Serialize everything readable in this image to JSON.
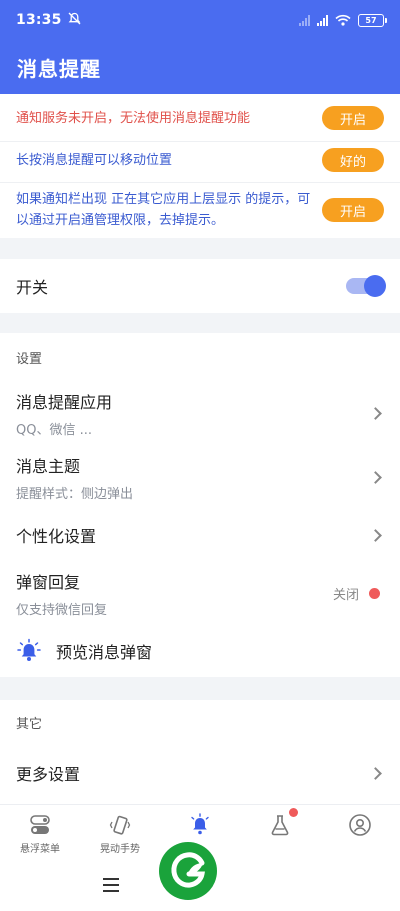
{
  "status_bar": {
    "time": "13:35",
    "battery": "57"
  },
  "app_bar": {
    "title": "消息提醒"
  },
  "notices": [
    {
      "text": "通知服务未开启，无法使用消息提醒功能",
      "button": "开启",
      "color": "#e0504a"
    },
    {
      "text": "长按消息提醒可以移动位置",
      "button": "好的",
      "color": "#3a5bd0"
    },
    {
      "text": "如果通知栏出现 正在其它应用上层显示 的提示，可以通过开启通管理权限，去掉提示。",
      "button": "开启",
      "color": "#3a5bd0"
    }
  ],
  "switch_row": {
    "label": "开关",
    "on": true
  },
  "settings": {
    "section_title": "设置",
    "items": [
      {
        "label": "消息提醒应用",
        "sub": "QQ、微信 ..."
      },
      {
        "label": "消息主题",
        "sub": "提醒样式：侧边弹出"
      },
      {
        "label": "个性化设置"
      },
      {
        "label": "弹窗回复",
        "sub": "仅支持微信回复",
        "status": "关闭"
      },
      {
        "label": "预览消息弹窗"
      }
    ]
  },
  "other": {
    "section_title": "其它",
    "items": [
      {
        "label": "更多设置"
      }
    ]
  },
  "bottom_nav": [
    {
      "label": "悬浮菜单"
    },
    {
      "label": "晃动手势"
    },
    {
      "label": ""
    },
    {
      "label": ""
    },
    {
      "label": ""
    }
  ],
  "colors": {
    "primary": "#4a6cf0",
    "accent": "#f7a020",
    "alert": "#ef5a5a"
  }
}
